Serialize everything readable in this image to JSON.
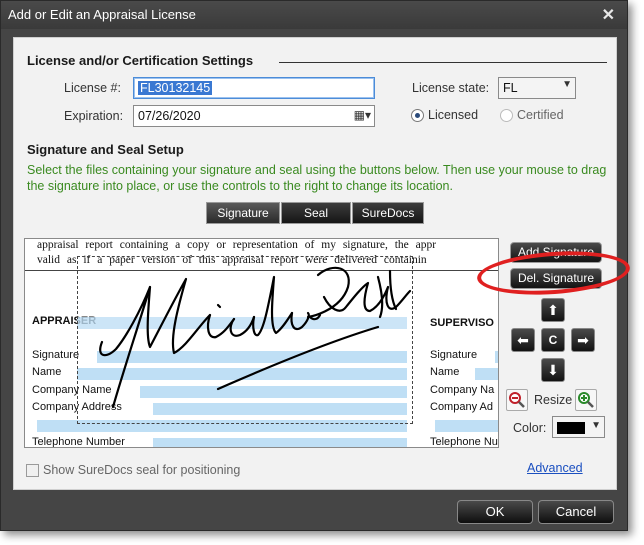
{
  "window": {
    "title": "Add or Edit an Appraisal License",
    "close_icon": "✕"
  },
  "license": {
    "section_title": "License and/or Certification Settings",
    "number_label": "License #:",
    "number_value": "FL30132145",
    "state_label": "License state:",
    "state_value": "FL",
    "expiration_label": "Expiration:",
    "expiration_value": "07/26/2020",
    "licensed_label": "Licensed",
    "certified_label": "Certified",
    "selected_type": "Licensed"
  },
  "signature": {
    "section_title": "Signature and Seal Setup",
    "instructions": "Select the files containing your signature and seal using the buttons below. Then use your mouse to drag the signature into place, or use the controls to the right to change its location.",
    "tabs": [
      {
        "label": "Signature",
        "active": true
      },
      {
        "label": "Seal",
        "active": false
      },
      {
        "label": "SureDocs",
        "active": false
      }
    ]
  },
  "preview": {
    "line1": "appraisal report containing a copy or representation of my signature, the appr",
    "line2": "valid as if a paper version of this appraisal report were delivered containin",
    "appraiser_heading": "APPRAISER",
    "supervisor_heading": "SUPERVISO",
    "appraiser_fields": [
      "Signature",
      "Name",
      "Company Name",
      "Company Address",
      "Telephone Number"
    ],
    "supervisor_fields": [
      "Signature",
      "Name",
      "Company Na",
      "Company Ad",
      "Telephone Nu"
    ]
  },
  "controls": {
    "add_signature": "Add Signature",
    "del_signature": "Del. Signature",
    "center": "C",
    "resize_label": "Resize",
    "color_label": "Color:",
    "color_value": "#000000",
    "advanced_link": "Advanced"
  },
  "footer": {
    "suredocs_checkbox": "Show SureDocs seal for positioning",
    "ok": "OK",
    "cancel": "Cancel"
  },
  "colors": {
    "accent_highlight": "#e02020",
    "instruction_text": "#3a8a20",
    "field_fill": "#bfdff5"
  }
}
